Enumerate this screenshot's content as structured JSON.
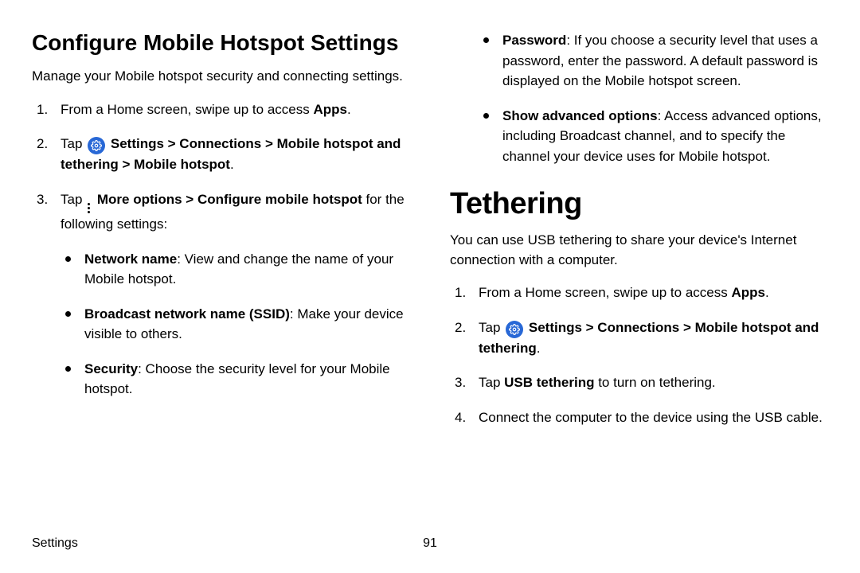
{
  "left": {
    "heading": "Configure Mobile Hotspot Settings",
    "intro": "Manage your Mobile hotspot security and connecting settings.",
    "step1_a": "From a Home screen, swipe up to access ",
    "step1_b": "Apps",
    "step1_c": ".",
    "step2_a": "Tap ",
    "step2_b": " Settings > Connections > Mobile hotspot and tethering > Mobile hotspot",
    "step2_c": ".",
    "step3_a": "Tap ",
    "step3_b": " More options > Configure mobile hotspot",
    "step3_c": " for the following settings:",
    "bullets": {
      "b1_a": "Network name",
      "b1_b": ": View and change the name of your Mobile hotspot.",
      "b2_a": "Broadcast network name (SSID)",
      "b2_b": ": Make your device visible to others.",
      "b3_a": "Security",
      "b3_b": ": Choose the security level for your Mobile hotspot."
    }
  },
  "right": {
    "bullets_top": {
      "b1_a": "Password",
      "b1_b": ": If you choose a security level that uses a password, enter the password. A default password is displayed on the Mobile hotspot screen.",
      "b2_a": "Show advanced options",
      "b2_b": ": Access advanced options, including Broadcast channel, and to specify the channel your device uses for Mobile hotspot."
    },
    "heading": "Tethering",
    "intro": "You can use USB tethering to share your device's Internet connection with a computer.",
    "step1_a": "From a Home screen, swipe up to access ",
    "step1_b": "Apps",
    "step1_c": ".",
    "step2_a": "Tap ",
    "step2_b": " Settings > Connections > Mobile hotspot and tethering",
    "step2_c": ".",
    "step3_a": "Tap ",
    "step3_b": "USB tethering",
    "step3_c": " to turn on tethering.",
    "step4": "Connect the computer to the device using the USB cable."
  },
  "footer": {
    "label": "Settings",
    "page": "91"
  }
}
